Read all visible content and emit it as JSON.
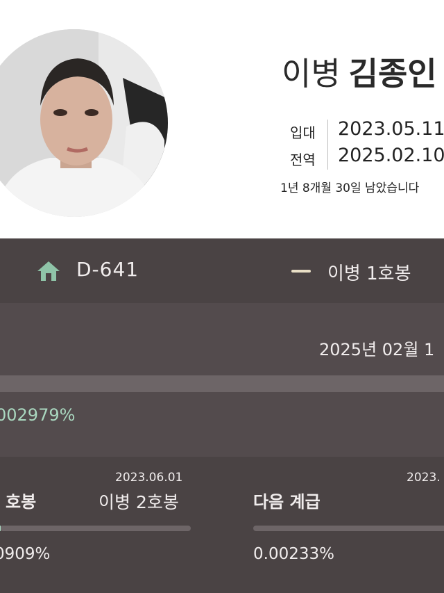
{
  "profile": {
    "avatar_icon": "profile-photo",
    "rank": "이병",
    "name": "김종인",
    "enlist_label": "입대",
    "enlist_date": "2023.05.11",
    "discharge_label": "전역",
    "discharge_date": "2025.02.10",
    "remaining": "1년 8개월 30일 남았습니다"
  },
  "summary": {
    "home_icon": "home-icon",
    "dday": "D-641",
    "rank_label": "이병 1호봉",
    "rank_color": "#e9dfc6"
  },
  "progress": {
    "end_date": "2025년 02월 1",
    "percent": "002979%",
    "fill": 2.979e-05,
    "accent": "#a9d7bf"
  },
  "cards": [
    {
      "title": "호봉",
      "next_date": "2023.06.01",
      "next_rank": "이병 2호봉",
      "percent": "0909%",
      "fill": 0.000909
    },
    {
      "title": "다음 계급",
      "next_date": "2023.",
      "percent": "0.00233%",
      "fill": 2.33e-05
    }
  ]
}
